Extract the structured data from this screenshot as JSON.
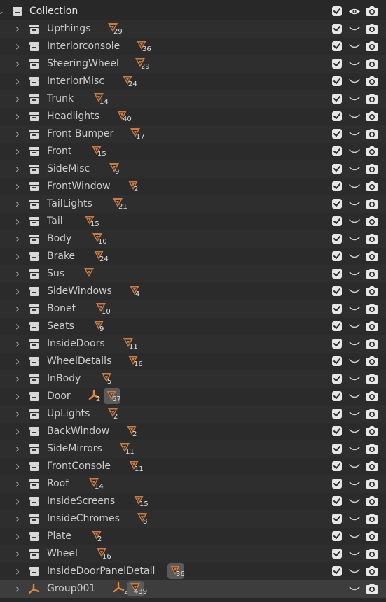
{
  "root": {
    "label": "Collection"
  },
  "items": [
    {
      "label": "Upthings",
      "count": "29",
      "cpos": 153
    },
    {
      "label": "Interiorconsole",
      "count": "36",
      "cpos": 194
    },
    {
      "label": "SteeringWheel",
      "count": "29",
      "cpos": 192
    },
    {
      "label": "InteriorMisc",
      "count": "24",
      "cpos": 174
    },
    {
      "label": "Trunk",
      "count": "14",
      "cpos": 133
    },
    {
      "label": "Headlights",
      "count": "40",
      "cpos": 166
    },
    {
      "label": "Front Bumper",
      "count": "17",
      "cpos": 185
    },
    {
      "label": "Front",
      "count": "15",
      "cpos": 130
    },
    {
      "label": "SideMisc",
      "count": "9",
      "cpos": 155
    },
    {
      "label": "FrontWindow",
      "count": "2",
      "cpos": 182
    },
    {
      "label": "TailLights",
      "count": "21",
      "cpos": 160
    },
    {
      "label": "Tail",
      "count": "15",
      "cpos": 120
    },
    {
      "label": "Body",
      "count": "10",
      "cpos": 131
    },
    {
      "label": "Brake",
      "count": "24",
      "cpos": 133
    },
    {
      "label": "Sus",
      "count": "",
      "cpos": 119
    },
    {
      "label": "SideWindows",
      "count": "4",
      "cpos": 184
    },
    {
      "label": "Bonet",
      "count": "10",
      "cpos": 136
    },
    {
      "label": "Seats",
      "count": "9",
      "cpos": 133
    },
    {
      "label": "InsideDoors",
      "count": "11",
      "cpos": 175
    },
    {
      "label": "WheelDetails",
      "count": "16",
      "cpos": 182
    },
    {
      "label": "InBody",
      "count": "5",
      "cpos": 144
    },
    {
      "label": "Door",
      "count": "67",
      "cpos": 151,
      "modifier": "2",
      "boxed": true
    },
    {
      "label": "UpLights",
      "count": "2",
      "cpos": 153
    },
    {
      "label": "BackWindow",
      "count": "2",
      "cpos": 180
    },
    {
      "label": "SideMirrors",
      "count": "11",
      "cpos": 170
    },
    {
      "label": "FrontConsole",
      "count": "11",
      "cpos": 183
    },
    {
      "label": "Roof",
      "count": "14",
      "cpos": 126
    },
    {
      "label": "InsideScreens",
      "count": "15",
      "cpos": 190
    },
    {
      "label": "InsideChromes",
      "count": "8",
      "cpos": 195
    },
    {
      "label": "Plate",
      "count": "2",
      "cpos": 130
    },
    {
      "label": "Wheel",
      "count": "16",
      "cpos": 137
    },
    {
      "label": "InsideDoorPanelDetail",
      "count": "36",
      "cpos": 242,
      "boxed": true
    }
  ],
  "group": {
    "label": "Group001",
    "modifier": "2",
    "count": "439"
  },
  "colors": {
    "accent": "#e0883a",
    "mesh": "#c97b43",
    "bg": "#282828",
    "selected": "#3d3d3d"
  },
  "icons": {
    "collection": "collection-icon",
    "mesh": "mesh-data-icon",
    "empty": "empty-axis-icon",
    "checkbox": "checkbox-checked-icon",
    "eye_open": "eye-open-icon",
    "eye_closed": "eye-closed-icon",
    "camera": "camera-icon"
  }
}
